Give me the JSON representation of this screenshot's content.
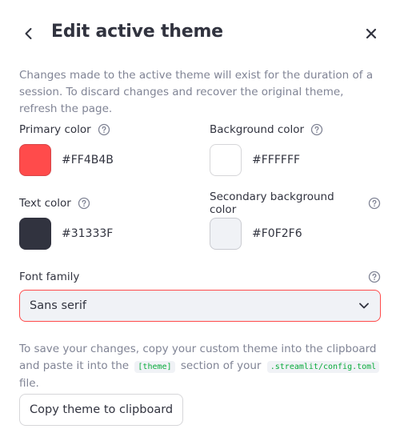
{
  "dialog": {
    "title": "Edit active theme",
    "description": "Changes made to the active theme will exist for the duration of a session. To discard changes and recover the original theme, refresh the page."
  },
  "colors": {
    "primary": {
      "label": "Primary color",
      "hex": "#FF4B4B",
      "swatch": "#ff4b4b"
    },
    "background": {
      "label": "Background color",
      "hex": "#FFFFFF",
      "swatch": "#ffffff"
    },
    "text": {
      "label": "Text color",
      "hex": "#31333F",
      "swatch": "#31333f"
    },
    "secondary": {
      "label": "Secondary background color",
      "hex": "#F0F2F6",
      "swatch": "#f0f2f6"
    }
  },
  "font": {
    "label": "Font family",
    "selected": "Sans serif"
  },
  "save_info": {
    "part1": "To save your changes, copy your custom theme into the clipboard and paste it into the",
    "code1": "[theme]",
    "part2": "section of your",
    "code2": ".streamlit/config.toml",
    "part3": "file."
  },
  "copy_button": "Copy theme to clipboard",
  "icons": {
    "back": "chevron-left-icon",
    "close": "close-icon",
    "help": "help-circle-icon",
    "dropdown": "chevron-down-icon"
  },
  "accent_color": "#ff4b4b"
}
